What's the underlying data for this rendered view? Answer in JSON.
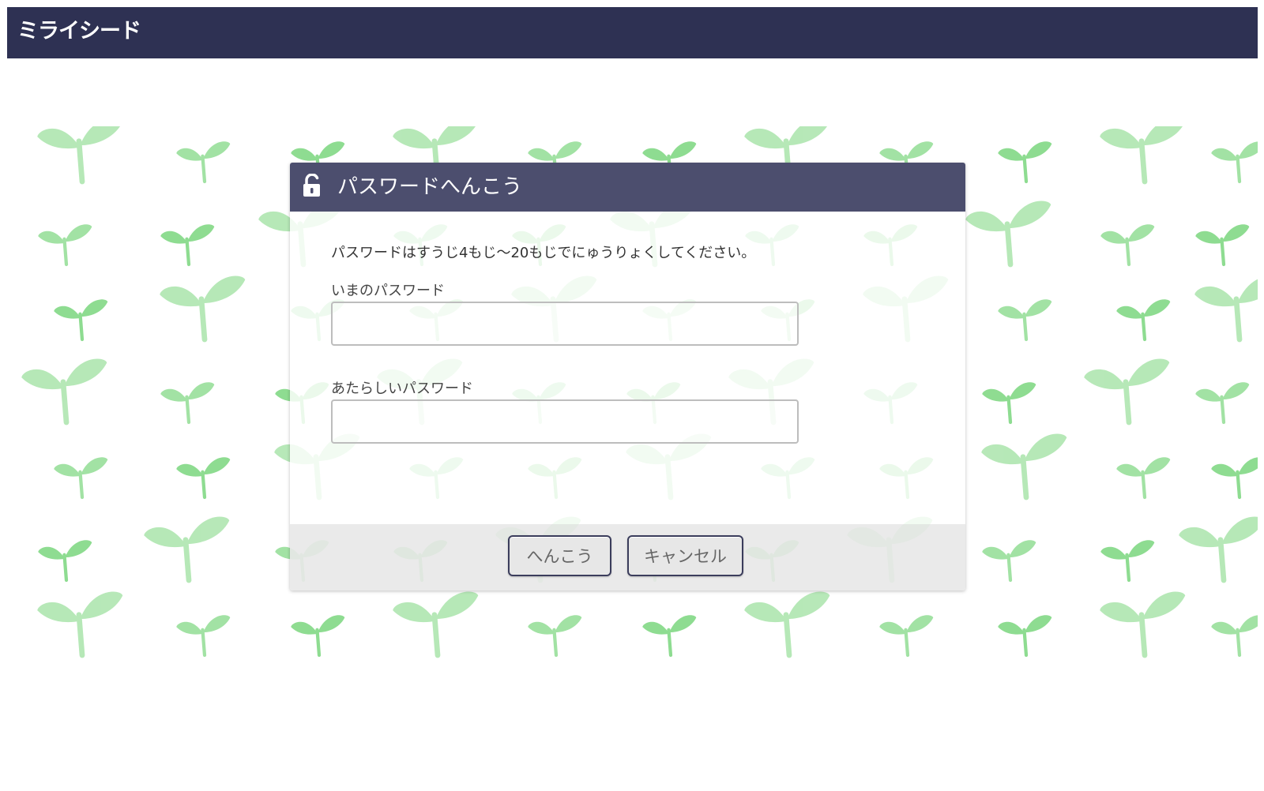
{
  "header": {
    "logo_text": "ミライシード"
  },
  "dialog": {
    "title": "パスワードへんこう",
    "lock_icon": "unlock-icon",
    "hint": "パスワードはすうじ4もじ〜20もじでにゅうりょくしてください。",
    "current_password": {
      "label": "いまのパスワード",
      "value": ""
    },
    "new_password": {
      "label": "あたらしいパスワード",
      "value": ""
    },
    "buttons": {
      "change": "へんこう",
      "cancel": "キャンセル"
    }
  },
  "colors": {
    "topbar": "#2e3153",
    "dialog_header": "#4c4e6e",
    "sprout": "#7bd67e"
  }
}
